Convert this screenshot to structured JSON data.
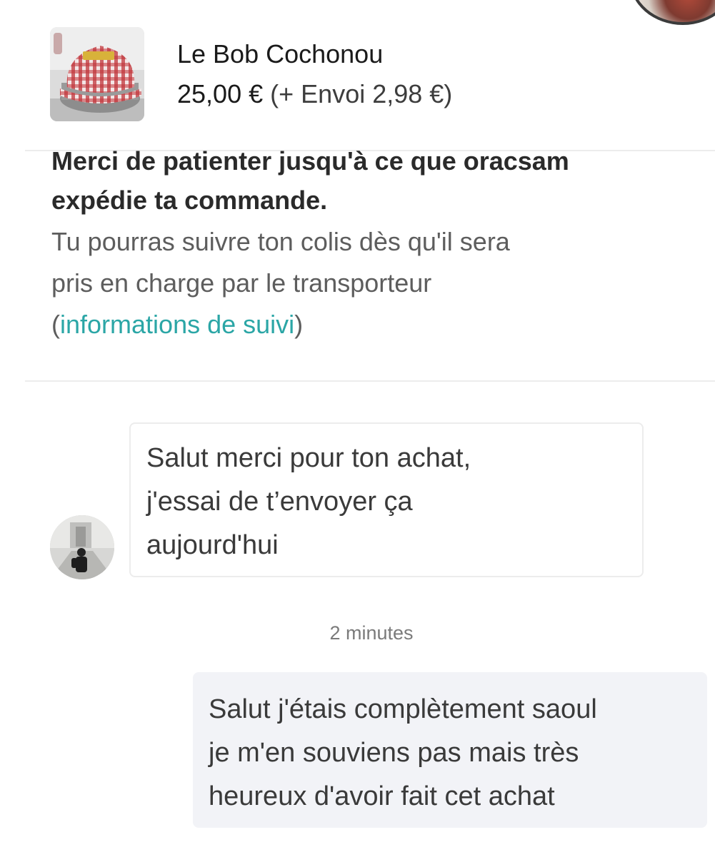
{
  "item": {
    "title": "Le Bob Cochonou",
    "price": "25,00 €",
    "shipping": "(+ Envoi 2,98 €)"
  },
  "status": {
    "bold_line1": "Merci de patienter jusqu'à ce que oracsam",
    "bold_line2": "expédie ta commande.",
    "info_line1": "Tu pourras suivre ton colis dès qu'il sera",
    "info_line2": "pris en charge par le transporteur",
    "paren_open": "(",
    "link_text": "informations de suivi",
    "paren_close": ")"
  },
  "messages": {
    "incoming": {
      "lines": [
        "Salut merci pour ton achat,",
        "j'essai de t’envoyer ça",
        "aujourd'hui"
      ]
    },
    "timestamp": "2 minutes",
    "outgoing": {
      "lines": [
        "Salut j'étais complètement saoul",
        "je m'en souviens pas mais très",
        "heureux d'avoir fait cet achat"
      ]
    }
  },
  "colors": {
    "link": "#2ba6a6",
    "outgoing_bubble": "#f2f3f7",
    "divider": "#ececec"
  },
  "icons": {
    "thumbnail": "item-photo-red-gingham-bucket-hat",
    "avatar": "seller-avatar-photo",
    "profile": "profile-photo"
  }
}
